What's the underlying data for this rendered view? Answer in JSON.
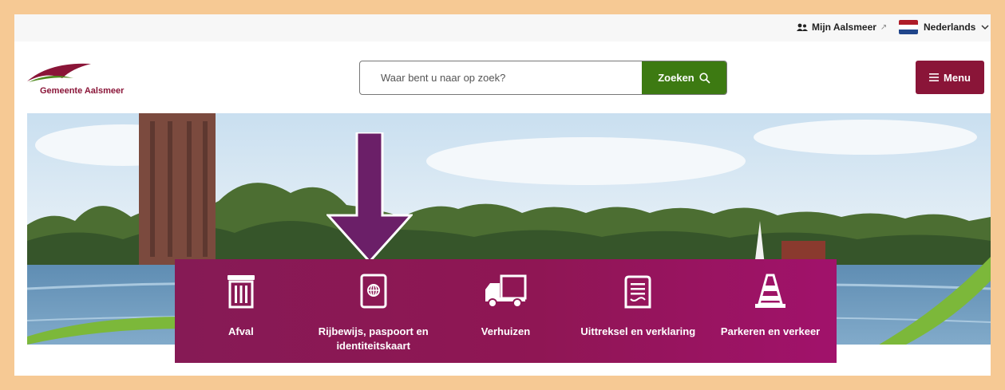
{
  "topbar": {
    "account_label": "Mijn Aalsmeer",
    "language_label": "Nederlands",
    "flag_colors": [
      "#ae1c28",
      "#ffffff",
      "#21468b"
    ]
  },
  "header": {
    "logo_text": "Gemeente Aalsmeer",
    "search_placeholder": "Waar bent u naar op zoek?",
    "search_button_label": "Zoeken",
    "menu_label": "Menu"
  },
  "colors": {
    "brand": "#8a1538",
    "search_button": "#3d7a12",
    "tile_bg": "#8f1654",
    "arrow": "#6b1f68",
    "frame": "#f6c994"
  },
  "tiles": [
    {
      "label": "Afval",
      "icon": "trash-bin-icon"
    },
    {
      "label": "Rijbewijs, paspoort en identiteitskaart",
      "icon": "passport-icon"
    },
    {
      "label": "Verhuizen",
      "icon": "moving-truck-icon"
    },
    {
      "label": "Uittreksel en verklaring",
      "icon": "document-icon"
    },
    {
      "label": "Parkeren en verkeer",
      "icon": "traffic-cone-icon"
    }
  ]
}
